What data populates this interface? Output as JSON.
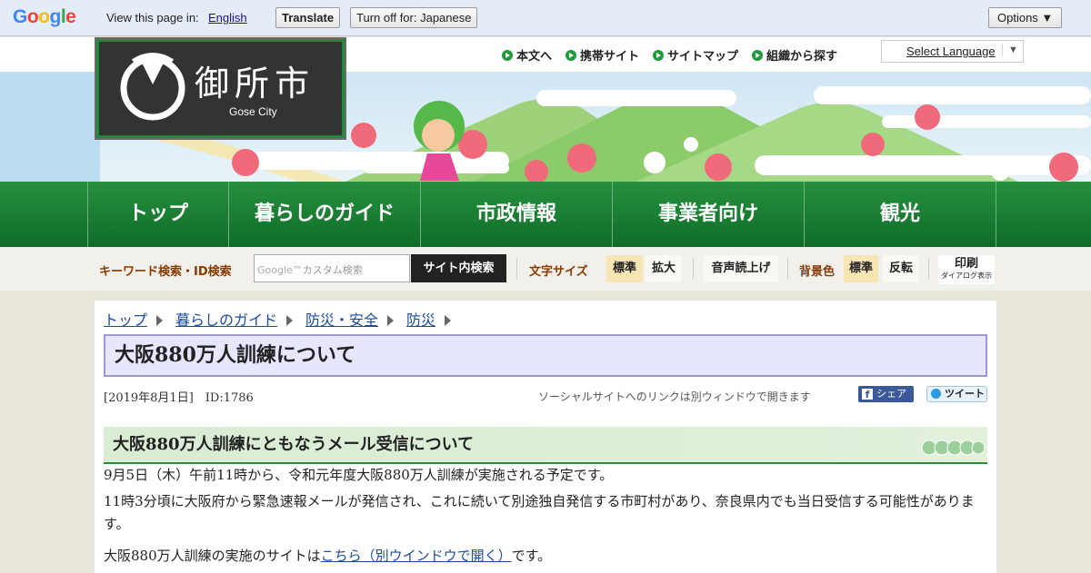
{
  "google_bar": {
    "logo_letters": [
      "G",
      "o",
      "o",
      "g",
      "l",
      "e"
    ],
    "logo_colors": [
      "#4285f4",
      "#ea4335",
      "#fbbc05",
      "#4285f4",
      "#34a853",
      "#ea4335"
    ],
    "view_label": "View this page in:",
    "language_link": "English",
    "translate_button": "Translate",
    "turnoff_button": "Turn off for: Japanese",
    "options_button": "Options ▼"
  },
  "header": {
    "logo_title": "御所市",
    "logo_subtitle": "Gose City",
    "top_links": [
      "本文へ",
      "携帯サイト",
      "サイトマップ",
      "組織から探す"
    ],
    "select_language": "Select Language",
    "select_arrow": "▼"
  },
  "nav": [
    "トップ",
    "暮らしのガイド",
    "市政情報",
    "事業者向け",
    "観光"
  ],
  "tools": {
    "keyword_label": "キーワード検索・ID検索",
    "search_placeholder": "カスタム検索",
    "search_google_mark": "Google™",
    "search_button": "サイト内検索",
    "font_size_label": "文字サイズ",
    "font_standard": "標準",
    "font_large": "拡大",
    "read_aloud": "音声読上げ",
    "bg_label": "背景色",
    "bg_standard": "標準",
    "bg_invert": "反転",
    "print_label": "印刷",
    "print_sub": "ダイアログ表示"
  },
  "breadcrumb": [
    "トップ",
    "暮らしのガイド",
    "防災・安全",
    "防災"
  ],
  "page": {
    "title": "大阪880万人訓練について",
    "date_id": "[2019年8月1日]　ID:1786",
    "social_note": "ソーシャルサイトへのリンクは別ウィンドウで開きます",
    "fb_share": "シェア",
    "tweet": "ツイート",
    "h2": "大阪880万人訓練にともなうメール受信について",
    "p1": "9月5日（木）午前11時から、令和元年度大阪880万人訓練が実施される予定です。",
    "p2": "11時3分頃に大阪府から緊急速報メールが発信され、これに続いて別途独自発信する市町村があり、奈良県内でも当日受信する可能性があります。",
    "p3_before": "大阪880万人訓練の実施のサイトは",
    "p3_link": "こちら（別ウインドウで開く）",
    "p3_after": "です。"
  }
}
